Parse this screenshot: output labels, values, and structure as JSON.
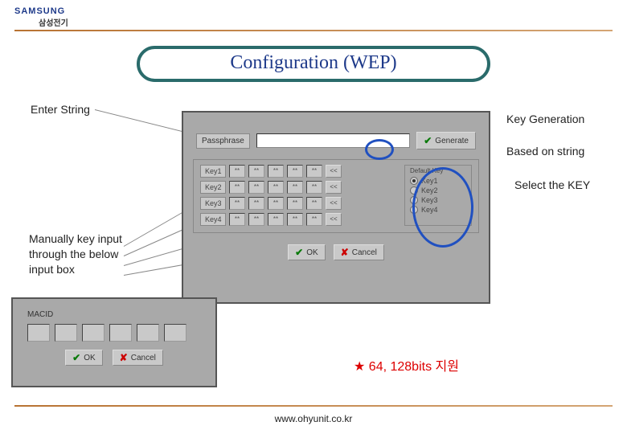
{
  "header": {
    "logo": "SAMSUNG",
    "logo_sub": "삼성전기"
  },
  "title": "Configuration (WEP)",
  "annotations": {
    "enter_string": "Enter String",
    "key_generation": "Key Generation",
    "based_on_string": "Based on string",
    "select_key": "Select the KEY",
    "manual_input": "Manually key input through the below input box"
  },
  "dialog1": {
    "passphrase_label": "Passphrase",
    "passphrase_value": "",
    "generate_label": "Generate",
    "keys_group_label": "",
    "keys": [
      {
        "label": "Key1",
        "cells": [
          "**",
          "**",
          "**",
          "**",
          "**"
        ],
        "clear": "<<"
      },
      {
        "label": "Key2",
        "cells": [
          "**",
          "**",
          "**",
          "**",
          "**"
        ],
        "clear": "<<"
      },
      {
        "label": "Key3",
        "cells": [
          "**",
          "**",
          "**",
          "**",
          "**"
        ],
        "clear": "<<"
      },
      {
        "label": "Key4",
        "cells": [
          "**",
          "**",
          "**",
          "**",
          "**"
        ],
        "clear": "<<"
      }
    ],
    "default_key_label": "Default Key",
    "radios": [
      {
        "label": "Key1",
        "selected": true
      },
      {
        "label": "Key2",
        "selected": false
      },
      {
        "label": "Key3",
        "selected": false
      },
      {
        "label": "Key4",
        "selected": false
      }
    ],
    "ok_label": "OK",
    "cancel_label": "Cancel"
  },
  "dialog2": {
    "macid_label": "MACID",
    "ok_label": "OK",
    "cancel_label": "Cancel"
  },
  "support_note": "★ 64, 128bits 지원",
  "footer": "www.ohyunit.co.kr"
}
